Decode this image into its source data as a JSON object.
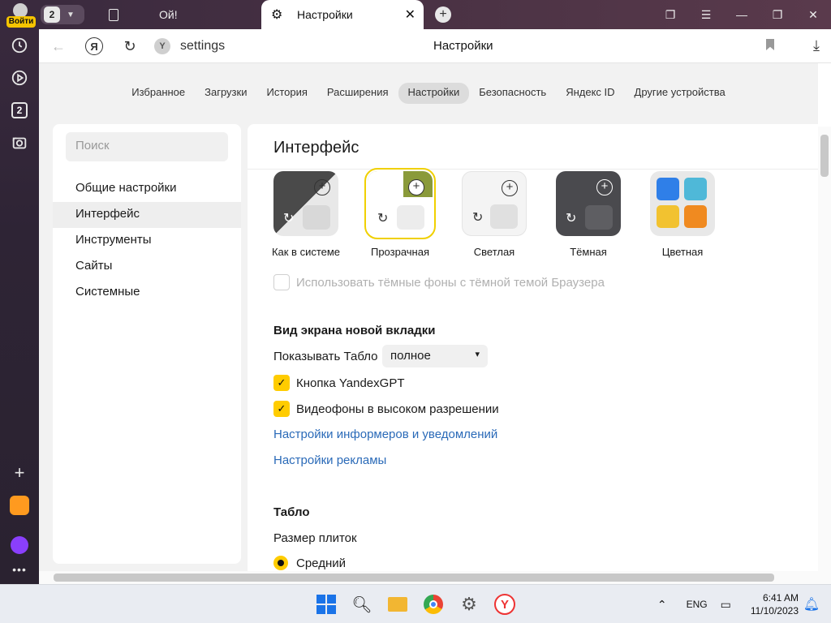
{
  "rail": {
    "login_label": "Войти",
    "tabs_badge": "2"
  },
  "tabs": {
    "counter": "2",
    "items": [
      {
        "title": "Ой!",
        "active": false
      },
      {
        "title": "Настройки",
        "active": true
      }
    ],
    "close_glyph": "✕",
    "new_tab_glyph": "+"
  },
  "address": {
    "url": "settings",
    "page_title": "Настройки",
    "site_icon_letter": "Y"
  },
  "topnav": {
    "items": [
      "Избранное",
      "Загрузки",
      "История",
      "Расширения",
      "Настройки",
      "Безопасность",
      "Яндекс ID",
      "Другие устройства"
    ],
    "active_index": 4
  },
  "sidebar": {
    "search_placeholder": "Поиск",
    "items": [
      {
        "label": "Общие настройки",
        "active": false
      },
      {
        "label": "Интерфейс",
        "active": true
      },
      {
        "label": "Инструменты",
        "active": false
      },
      {
        "label": "Сайты",
        "active": false
      },
      {
        "label": "Системные",
        "active": false
      }
    ]
  },
  "main": {
    "heading": "Интерфейс",
    "themes": [
      {
        "label": "Как в системе",
        "selected": false
      },
      {
        "label": "Прозрачная",
        "selected": true
      },
      {
        "label": "Светлая",
        "selected": false
      },
      {
        "label": "Тёмная",
        "selected": false
      },
      {
        "label": "Цветная",
        "selected": false
      }
    ],
    "dark_bg_checkbox": {
      "label": "Использовать тёмные фоны с тёмной темой Браузера",
      "checked": false,
      "disabled": true
    },
    "newtab_section": {
      "title": "Вид экрана новой вкладки",
      "show_tablo_label": "Показывать Табло",
      "show_tablo_value": "полное",
      "checkboxes": [
        {
          "label": "Кнопка YandexGPT",
          "checked": true
        },
        {
          "label": "Видеофоны в высоком разрешении",
          "checked": true
        }
      ],
      "links": [
        "Настройки информеров и уведомлений",
        "Настройки рекламы"
      ]
    },
    "tablo_section": {
      "title": "Табло",
      "tile_size_label": "Размер плиток",
      "tile_size_value": "Средний"
    }
  },
  "taskbar": {
    "lang": "ENG",
    "time": "6:41 AM",
    "date": "11/10/2023"
  },
  "colors": {
    "accent_yellow": "#ffcc00",
    "link_blue": "#2a6ab8"
  }
}
